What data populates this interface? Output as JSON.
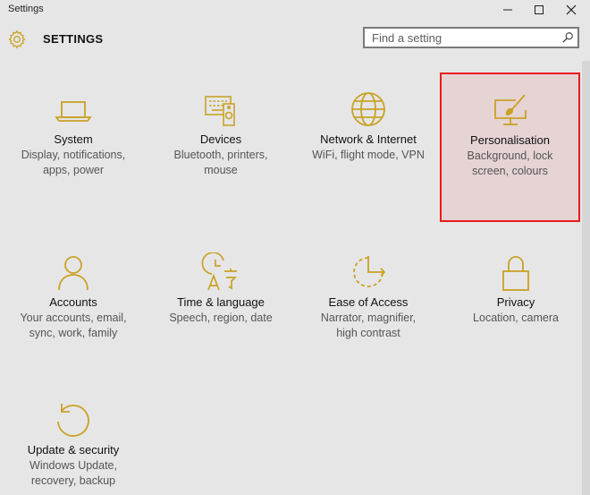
{
  "window": {
    "title": "Settings",
    "controls": [
      "minimize",
      "maximize",
      "close"
    ]
  },
  "header": {
    "title": "SETTINGS",
    "icon": "gear-icon"
  },
  "search": {
    "placeholder": "Find a setting",
    "value": "",
    "icon": "search-icon"
  },
  "colors": {
    "accent": "#c9a227",
    "selected_background": "#e6d3d4",
    "selected_border": "#e81c1c",
    "background": "#e6e6e6"
  },
  "tiles": [
    {
      "label": "System",
      "desc_lines": [
        "Display, notifications,",
        "apps, power"
      ],
      "icon": "laptop-icon",
      "selected": false
    },
    {
      "label": "Devices",
      "desc_lines": [
        "Bluetooth, printers,",
        "mouse"
      ],
      "icon": "keyboard-speaker-icon",
      "selected": false
    },
    {
      "label": "Network & Internet",
      "desc_lines": [
        "WiFi, flight mode, VPN"
      ],
      "icon": "globe-icon",
      "selected": false
    },
    {
      "label": "Personalisation",
      "desc_lines": [
        "Background, lock",
        "screen, colours"
      ],
      "icon": "paintbrush-monitor-icon",
      "selected": true
    },
    {
      "label": "Accounts",
      "desc_lines": [
        "Your accounts, email,",
        "sync, work, family"
      ],
      "icon": "person-icon",
      "selected": false
    },
    {
      "label": "Time & language",
      "desc_lines": [
        "Speech, region, date"
      ],
      "icon": "clock-language-icon",
      "selected": false
    },
    {
      "label": "Ease of Access",
      "desc_lines": [
        "Narrator, magnifier,",
        "high contrast"
      ],
      "icon": "ease-of-access-icon",
      "selected": false
    },
    {
      "label": "Privacy",
      "desc_lines": [
        "Location, camera"
      ],
      "icon": "padlock-icon",
      "selected": false
    },
    {
      "label": "Update & security",
      "desc_lines": [
        "Windows Update,",
        "recovery, backup"
      ],
      "icon": "refresh-arrow-icon",
      "selected": false
    }
  ]
}
